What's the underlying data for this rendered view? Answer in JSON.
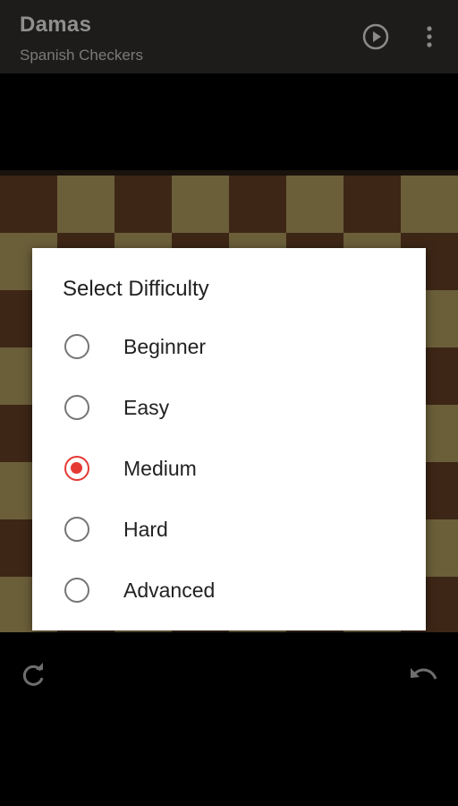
{
  "appbar": {
    "title": "Damas",
    "subtitle": "Spanish Checkers",
    "play_icon": "play-circle-icon",
    "more_icon": "more-vert-icon"
  },
  "board": {
    "dark_color": "#3d2616",
    "light_color": "#6b5f3a"
  },
  "dialog": {
    "title": "Select Difficulty",
    "options": [
      {
        "label": "Beginner",
        "selected": false
      },
      {
        "label": "Easy",
        "selected": false
      },
      {
        "label": "Medium",
        "selected": true
      },
      {
        "label": "Hard",
        "selected": false
      },
      {
        "label": "Advanced",
        "selected": false
      }
    ],
    "accent_color": "#e53935"
  },
  "controls": {
    "refresh_icon": "refresh-icon",
    "undo_icon": "undo-icon"
  }
}
